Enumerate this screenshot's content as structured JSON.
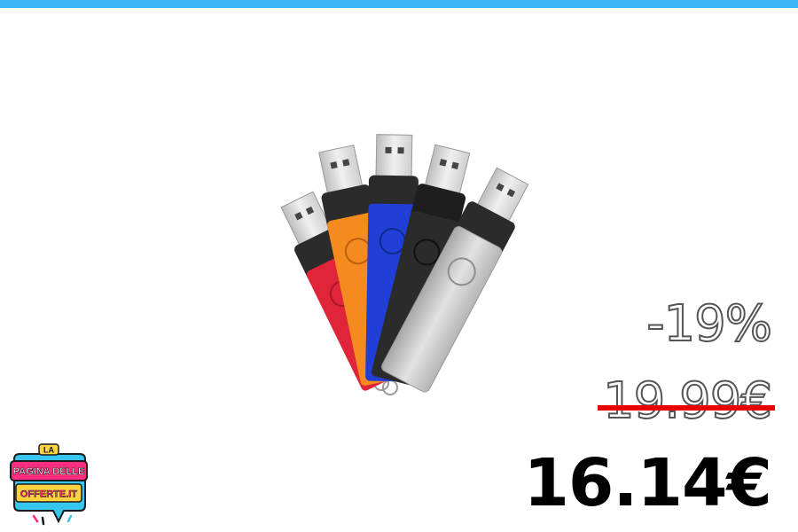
{
  "colors": {
    "top_bar": "#3db5f5",
    "strike": "#e80000",
    "drive_red": "#e0243a",
    "drive_orange": "#f58a1f",
    "drive_blue": "#1f3fd6",
    "drive_black": "#2b2b2b",
    "drive_silver": "#c9c9c9",
    "logo_pink": "#ff2d7f",
    "logo_cyan": "#36c6f0"
  },
  "product": {
    "image": "usb-flash-drives-five-colors"
  },
  "pricing": {
    "discount": "-19%",
    "old_price": "19.99€",
    "new_price": "16.14€"
  },
  "logo": {
    "line1": "LA",
    "line2": "PAGINA DELLE",
    "line3": "OFFERTE.IT"
  }
}
